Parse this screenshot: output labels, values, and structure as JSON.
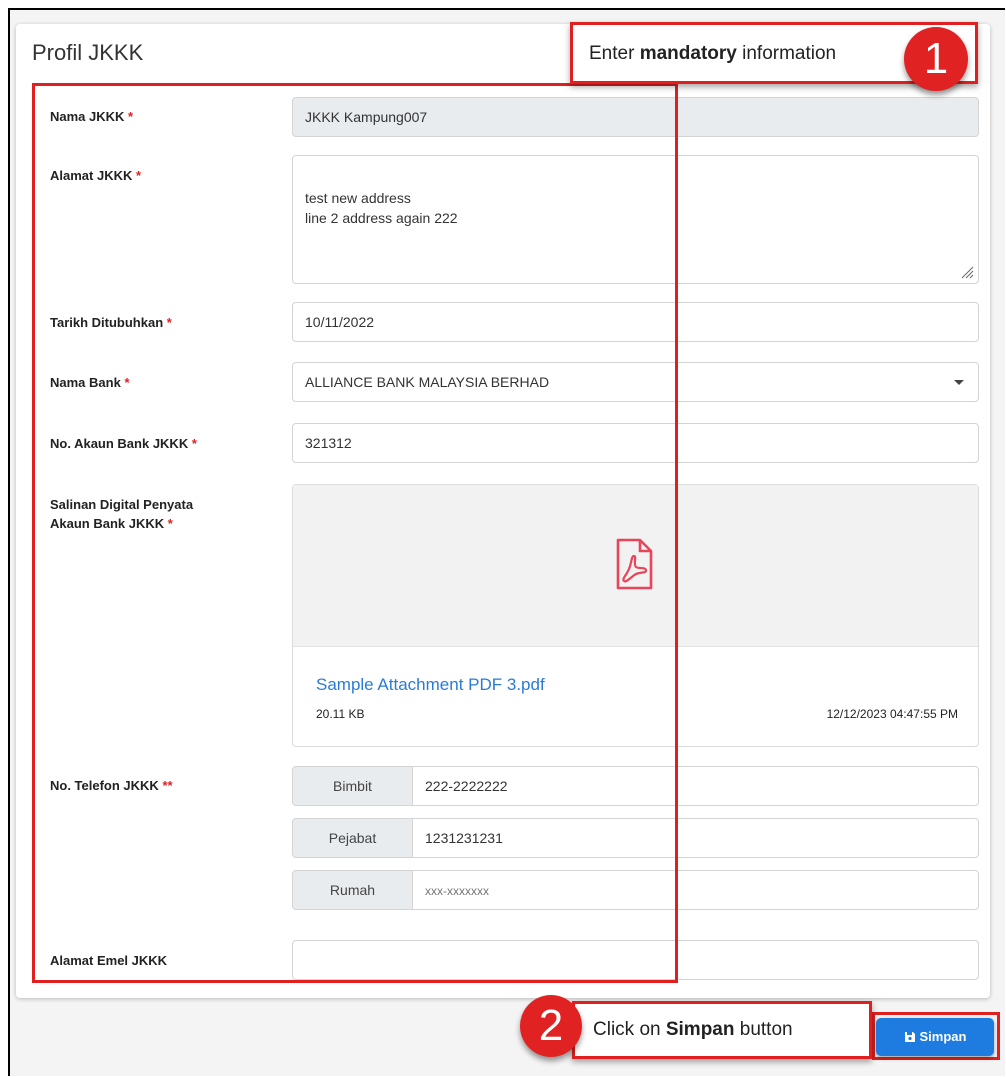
{
  "panel": {
    "title": "Profil JKKK"
  },
  "callouts": {
    "step1": {
      "number": "1",
      "text_before": "Enter ",
      "text_bold": "mandatory",
      "text_after": " information"
    },
    "step2": {
      "number": "2",
      "text_before": "Click on ",
      "text_bold": "Simpan",
      "text_after": " button"
    }
  },
  "form": {
    "nama": {
      "label": "Nama JKKK",
      "required": "*",
      "value": "JKKK Kampung007"
    },
    "alamat": {
      "label": "Alamat JKKK",
      "required": "*",
      "value": "test new address\nline 2 address again 222"
    },
    "tarikh": {
      "label": "Tarikh Ditubuhkan",
      "required": "*",
      "value": "10/11/2022"
    },
    "bank": {
      "label": "Nama Bank",
      "required": "*",
      "value": "ALLIANCE BANK MALAYSIA BERHAD"
    },
    "akaun": {
      "label": "No. Akaun Bank JKKK",
      "required": "*",
      "value": "321312"
    },
    "salinan": {
      "label_line1": "Salinan Digital Penyata",
      "label_line2": "Akaun Bank JKKK",
      "required": "*",
      "file_name": "Sample Attachment PDF 3.pdf",
      "file_size": "20.11 KB",
      "file_date": "12/12/2023 04:47:55 PM",
      "icon": "pdf-icon"
    },
    "telefon": {
      "label": "No. Telefon JKKK",
      "required": "**",
      "bimbit": {
        "label": "Bimbit",
        "value": "222-2222222"
      },
      "pejabat": {
        "label": "Pejabat",
        "value": "1231231231"
      },
      "rumah": {
        "label": "Rumah",
        "placeholder": "xxx-xxxxxxx"
      }
    },
    "emel": {
      "label": "Alamat Emel JKKK",
      "value": ""
    }
  },
  "actions": {
    "save_label": "Simpan",
    "save_icon": "floppy-disk-icon"
  },
  "colors": {
    "annotation": "#e02020",
    "primary": "#1e7be0",
    "link": "#2a7bd6",
    "pdf": "#e8455a"
  }
}
